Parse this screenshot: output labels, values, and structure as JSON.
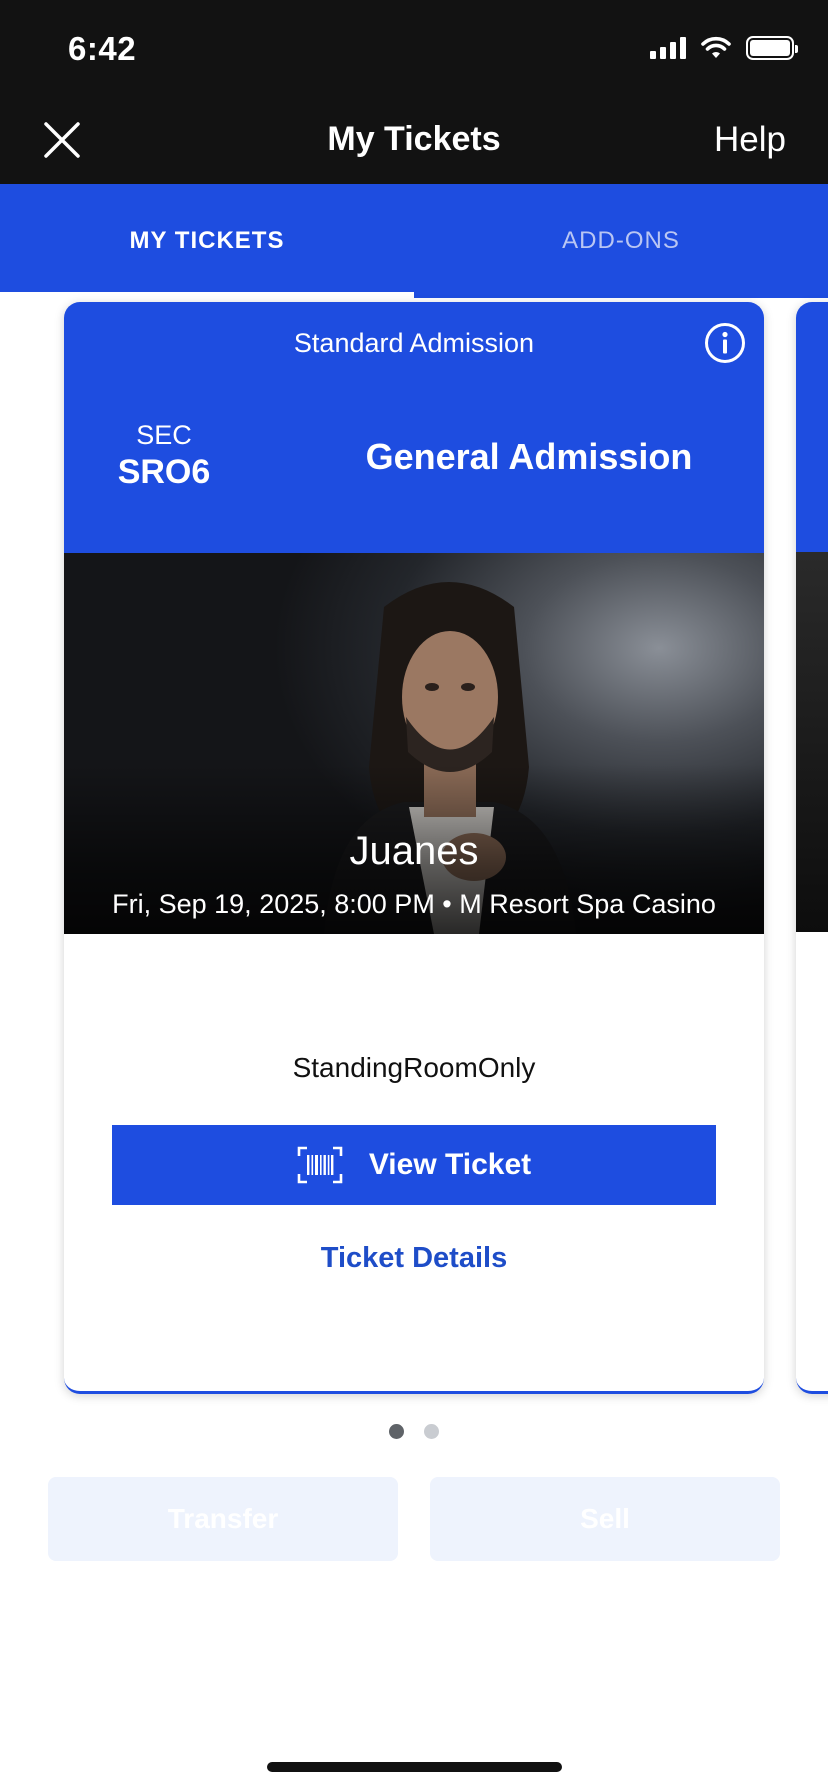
{
  "status_bar": {
    "time": "6:42",
    "icons": [
      "signal-icon",
      "wifi-icon",
      "battery-icon"
    ]
  },
  "nav": {
    "title": "My Tickets",
    "help_label": "Help",
    "close_icon": "close-icon"
  },
  "tabs": [
    {
      "label": "MY TICKETS",
      "active": true
    },
    {
      "label": "ADD-ONS",
      "active": false
    }
  ],
  "ticket": {
    "admission_type": "Standard Admission",
    "section_label": "SEC",
    "section_value": "SRO6",
    "area_name": "General Admission",
    "artist": "Juanes",
    "event_info": "Fri, Sep 19, 2025, 8:00 PM • M Resort Spa Casino",
    "seat_note": "StandingRoomOnly",
    "view_ticket_label": "View Ticket",
    "ticket_details_label": "Ticket Details"
  },
  "pagination": {
    "current": 1,
    "total": 2
  },
  "actions": {
    "transfer_label": "Transfer",
    "sell_label": "Sell",
    "enabled": false
  },
  "colors": {
    "brand_blue": "#1e4de0",
    "dark_bar": "#121212",
    "link_blue": "#1e4dc8",
    "disabled_bg": "#eef3fd"
  }
}
